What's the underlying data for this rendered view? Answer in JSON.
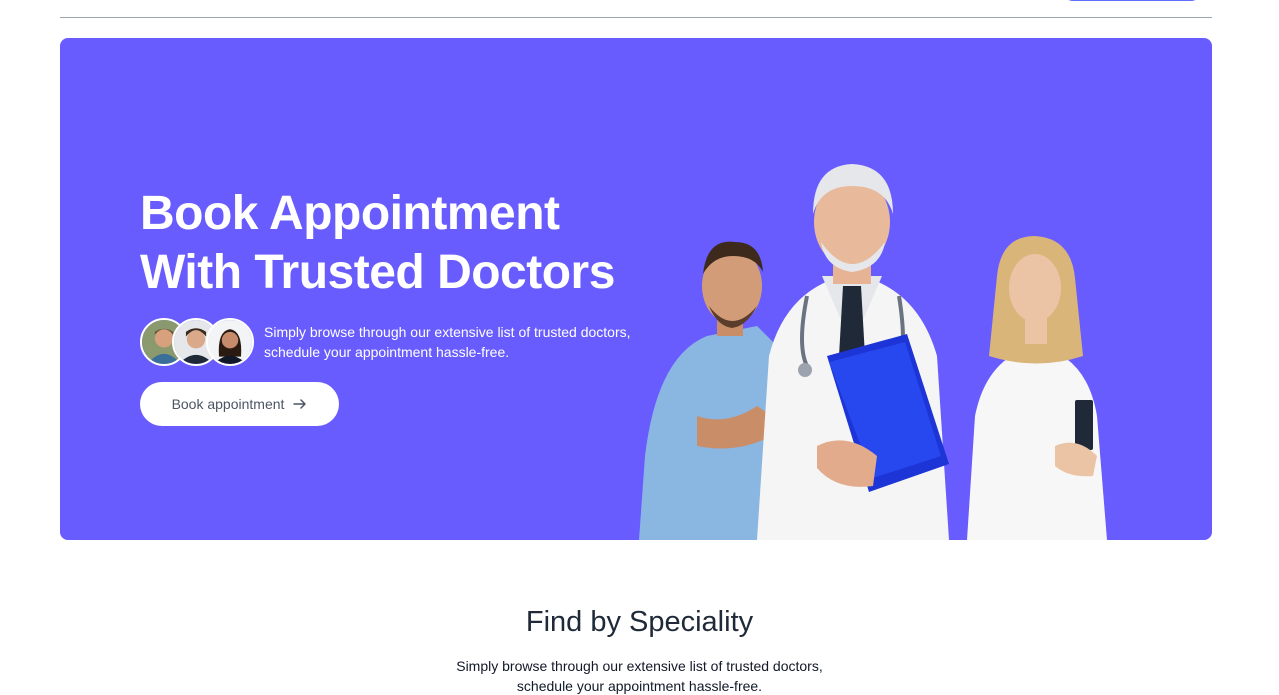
{
  "hero": {
    "title_line1": "Book Appointment",
    "title_line2": "With Trusted Doctors",
    "description_line1": "Simply browse through our extensive list of trusted doctors,",
    "description_line2": "schedule your appointment hassle-free.",
    "button_label": "Book appointment",
    "button_icon": "arrow-right-icon",
    "background_color": "#685cfe"
  },
  "speciality": {
    "title": "Find by Speciality",
    "description_line1": "Simply browse through our extensive list of trusted doctors,",
    "description_line2": "schedule your appointment hassle-free."
  },
  "colors": {
    "primary": "#5f6fff",
    "hero_bg": "#685cfe",
    "text_dark": "#1f2937"
  }
}
